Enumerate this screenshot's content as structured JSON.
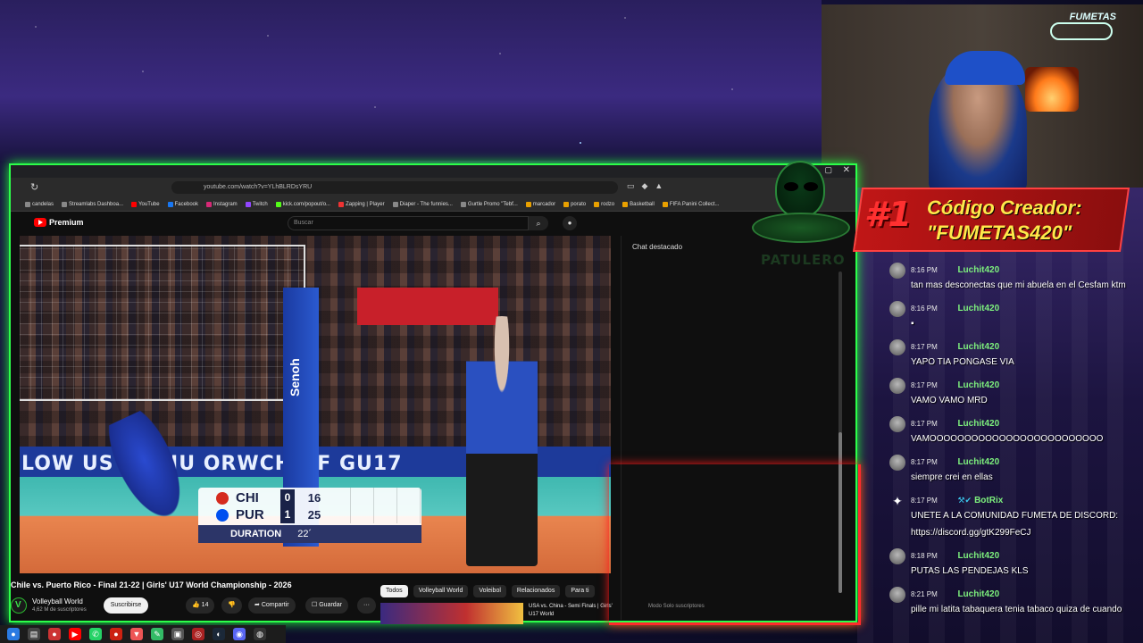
{
  "browser": {
    "url": "youtube.com/watch?v=YLhBLRDsYRU",
    "bookmarks": [
      "candelas",
      "Streamlabs Dashboa...",
      "YouTube",
      "Facebook",
      "Instagram",
      "Twitch",
      "kick.com/popout/o...",
      "Zapping | Player",
      "Diaper - The funnies...",
      "Gurtle Promo \"Tebf...",
      "marcador",
      "porato",
      "rodzo",
      "Basketball",
      "FIFA Panini Collect..."
    ]
  },
  "youtube": {
    "logo_text": "Premium",
    "search_placeholder": "Buscar",
    "video_title": "Chile vs. Puerto Rico - Final 21-22 | Girls' U17 World Championship - 2026",
    "channel_name": "Volleyball World",
    "channel_subs": "4,62 M de suscriptores",
    "subscribe_label": "Suscribirse",
    "likes": "14",
    "share_label": "Compartir",
    "save_label": "Guardar",
    "more_label": "···",
    "chips": [
      "Todos",
      "Volleyball World",
      "Voleibol",
      "Relacionados",
      "Para ti"
    ],
    "recommended_title": "USA vs. China - Semi Finals | Girls' U17 World",
    "live_chat_header": "Chat destacado",
    "live_chat_footer": "Modo Solo suscriptores"
  },
  "video": {
    "wall_text": "LOW US   :IVBJU  ORWCH #F  GU17",
    "pole_text": "Senoh",
    "score": {
      "teams": [
        {
          "name": "CHI",
          "sets": "0",
          "points": "16",
          "flag_color": "#d52b1e"
        },
        {
          "name": "PUR",
          "sets": "1",
          "points": "25",
          "flag_color": "#0050f0"
        }
      ],
      "duration_label": "DURATION",
      "duration_value": "22´"
    }
  },
  "overlay": {
    "creator_rank": "#1",
    "creator_title": "Código Creador:",
    "creator_code": "\"FUMETAS420\"",
    "alien_word": "PATULERO",
    "channel_logo": "FUMETAS"
  },
  "chat": [
    {
      "time": "8:16 PM",
      "user": "Luchit420",
      "text": "tan mas desconectas que mi abuela en el Cesfam ktm"
    },
    {
      "time": "8:16 PM",
      "user": "Luchit420",
      "text": ""
    },
    {
      "time": "8:17 PM",
      "user": "Luchit420",
      "text": "YAPO TIA PONGASE VIA"
    },
    {
      "time": "8:17 PM",
      "user": "Luchit420",
      "text": "VAMO VAMO MRD"
    },
    {
      "time": "8:17 PM",
      "user": "Luchit420",
      "text": "VAMOOOOOOOOOOOOOOOOOOOOOOOOO"
    },
    {
      "time": "8:17 PM",
      "user": "Luchit420",
      "text": "siempre crei en ellas"
    },
    {
      "time": "8:17 PM",
      "user": "BotRix",
      "text": "UNETE A LA COMUNIDAD FUMETA DE DISCORD: https://discord.gg/gtK299FeCJ",
      "bot": true
    },
    {
      "time": "8:18 PM",
      "user": "Luchit420",
      "text": "PUTAS LAS PENDEJAS KLS"
    },
    {
      "time": "8:21 PM",
      "user": "Luchit420",
      "text": "pille mi latita tabaquera tenia tabaco quiza de cuando"
    }
  ]
}
